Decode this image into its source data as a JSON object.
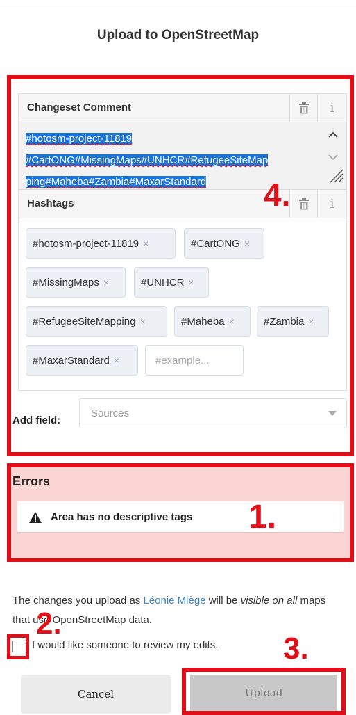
{
  "title": "Upload to OpenStreetMap",
  "changeset_comment": {
    "label": "Changeset Comment",
    "info_glyph": "i",
    "lines": [
      "#hotosm-project-11819",
      "#CartONG#MissingMaps#UNHCR#RefugeeSiteMap",
      "ping#Maheba#Zambia#MaxarStandard"
    ]
  },
  "hashtags": {
    "label": "Hashtags",
    "info_glyph": "i",
    "remove_glyph": "×",
    "tags": [
      "#hotosm-project-11819",
      "#CartONG",
      "#MissingMaps",
      "#UNHCR",
      "#RefugeeSiteMapping",
      "#Maheba",
      "#Zambia",
      "#MaxarStandard"
    ],
    "input_placeholder": "#example..."
  },
  "add_field": {
    "label": "Add field:",
    "placeholder": "Sources"
  },
  "errors": {
    "title": "Errors",
    "items": [
      "Area has no descriptive tags"
    ]
  },
  "upload_info": {
    "prefix": "The changes you upload as ",
    "user": "Léonie Miège",
    "middle": " will be ",
    "emphasis": "visible on all",
    "suffix": " maps that use OpenStreetMap data."
  },
  "review": {
    "label": "I would like someone to review my edits.",
    "checked": false
  },
  "buttons": {
    "cancel": "Cancel",
    "upload": "Upload"
  },
  "annotations": {
    "n1": "1.",
    "n2": "2.",
    "n3": "3.",
    "n4": "4."
  },
  "colors": {
    "highlight": "#e0101a",
    "selection": "#1a73d8",
    "error_bg": "#fbd4d4",
    "link": "#3a86c8"
  },
  "icons": [
    "trash-icon",
    "info-icon",
    "chevron-up-icon",
    "chevron-down-icon",
    "resize-handle-icon",
    "warning-icon",
    "remove-tag-icon",
    "dropdown-caret-icon"
  ]
}
